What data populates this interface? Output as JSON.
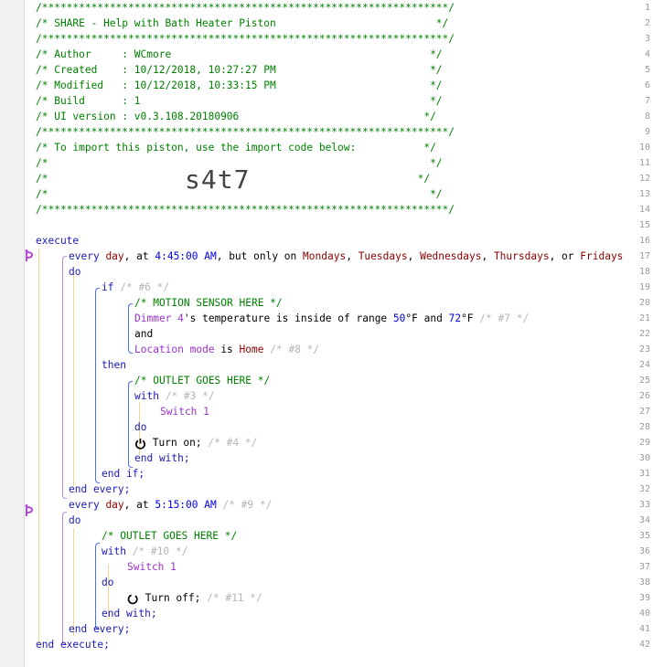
{
  "line_numbers": [
    "1",
    "2",
    "3",
    "4",
    "5",
    "6",
    "7",
    "8",
    "9",
    "10",
    "11",
    "12",
    "13",
    "14",
    "15",
    "16",
    "17",
    "18",
    "19",
    "20",
    "21",
    "22",
    "23",
    "24",
    "25",
    "26",
    "27",
    "28",
    "29",
    "30",
    "31",
    "32",
    "33",
    "34",
    "35",
    "36",
    "37",
    "38",
    "39",
    "40",
    "41",
    "42"
  ],
  "header": {
    "stars": "/******************************************************************/",
    "share": "/* SHARE - Help with Bath Heater Piston                          */",
    "author": "/* Author     : WCmore                                          */",
    "created": "/* Created    : 10/12/2018, 10:27:27 PM                         */",
    "modified": "/* Modified   : 10/12/2018, 10:33:15 PM                         */",
    "build": "/* Build      : 1                                               */",
    "ui_version": "/* UI version : v0.3.108.20180906                              */",
    "import": "/* To import this piston, use the import code below:           */",
    "blank": "/*                                                              */",
    "import_code": "s4t7"
  },
  "code": {
    "execute": "execute",
    "end_execute": "end execute;",
    "every": "every",
    "day": "day",
    "at": ", at",
    "time1": "4:45:00 AM",
    "but_only": ", but only on",
    "mon": "Mondays",
    "tue": "Tuesdays",
    "wed": "Wednesdays",
    "thu": "Thursdays",
    "or": ", or",
    "fri": "Fridays",
    "comma": ",",
    "do": "do",
    "if": "if",
    "c6": "/* #6 */",
    "motion_comment": "/* MOTION SENSOR HERE */",
    "dimmer": "Dimmer 4",
    "temp_text": "'s temperature is inside of range",
    "v50": "50",
    "degF1": "°F and",
    "v72": "72",
    "degF2": "°F",
    "c7": "/* #7 */",
    "and": "and",
    "location_mode": "Location mode",
    "is": "is",
    "home": "Home",
    "c8": "/* #8 */",
    "then": "then",
    "outlet_comment": "/* OUTLET GOES HERE */",
    "with": "with",
    "c3": "/* #3 */",
    "switch1": "Switch 1",
    "turn_on": "Turn on;",
    "c4": "/* #4 */",
    "end_with": "end with;",
    "end_if": "end if;",
    "end_every": "end every;",
    "time2": "5:15:00 AM",
    "c9": "/* #9 */",
    "c10": "/* #10 */",
    "turn_off": "Turn off;",
    "c11": "/* #11 */"
  }
}
